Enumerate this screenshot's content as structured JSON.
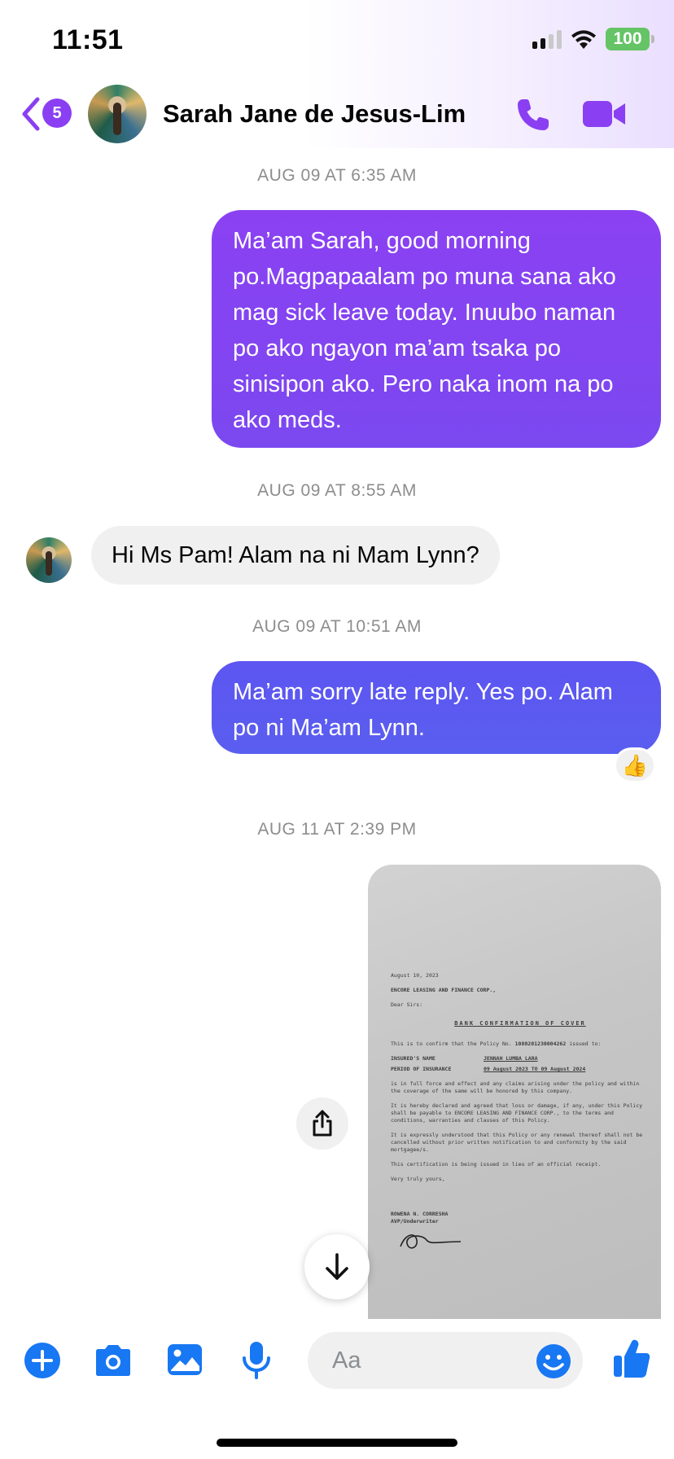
{
  "status_bar": {
    "time": "11:51",
    "battery": "100"
  },
  "header": {
    "unread_count": "5",
    "contact_name": "Sarah Jane de Jesus-Lim",
    "icons": [
      "back-chevron-icon",
      "phone-icon",
      "video-camera-icon"
    ]
  },
  "colors": {
    "accent": "#8a3ff2",
    "bubble_top": "#8a3ff2",
    "bubble_bottom": "#5a5ef0",
    "composer_icon": "#1877f2"
  },
  "messages": [
    {
      "timestamp": "AUG 09 AT 6:35 AM",
      "direction": "outgoing",
      "text": "Ma’am Sarah, good morning po.Magpapaalam po muna sana ako mag sick leave today. Inuubo naman po ako ngayon ma’am tsaka po sinisipon ako. Pero naka inom na po ako meds."
    },
    {
      "timestamp": "AUG 09 AT 8:55 AM",
      "direction": "incoming",
      "text": "Hi Ms Pam! Alam na ni Mam Lynn?"
    },
    {
      "timestamp": "AUG 09 AT 10:51 AM",
      "direction": "outgoing",
      "text": "Ma’am sorry late reply. Yes po. Alam po ni Ma’am Lynn.",
      "reaction": "👍"
    },
    {
      "timestamp": "AUG 11 AT 2:39 PM",
      "direction": "outgoing",
      "type": "photo"
    }
  ],
  "document": {
    "date": "August 10, 2023",
    "addressee": "ENCORE LEASING AND FINANCE CORP.,",
    "salutation": "Dear Sirs:",
    "title": "BANK CONFIRMATION OF COVER",
    "intro": "This is to confirm that the Policy No.",
    "policy_no": "1080201230004262",
    "intro_end": "issued to:",
    "insured_label": "INSURED'S NAME",
    "insured_value": "JENNAH LUMBA LARA",
    "period_label": "PERIOD OF INSURANCE",
    "period_value": "09 August 2023 TO 09 August 2024",
    "para1": "is in full force and effect and any claims arising under the policy and within the coverage of the same will be honored by this company.",
    "para2": "It is hereby declared and agreed that loss or damage, if any, under this Policy shall be payable to ENCORE LEASING AND FINANCE CORP., to the terms and conditions, warranties and clauses of this Policy.",
    "para3": "It is expressly understood that this Policy or any renewal thereof shall not be cancelled without prior written notification to and conformity by the said mortgagee/s.",
    "para4": "This certification is being issued in lieu of an official receipt.",
    "closing": "Very truly yours,",
    "signer": "ROWENA N. CORRESHA",
    "signer_title": "AVP/Underwriter"
  },
  "composer": {
    "placeholder": "Aa",
    "icons": [
      "plus-circle-icon",
      "camera-icon",
      "photo-gallery-icon",
      "microphone-icon",
      "emoji-icon",
      "thumbs-up-icon"
    ]
  }
}
